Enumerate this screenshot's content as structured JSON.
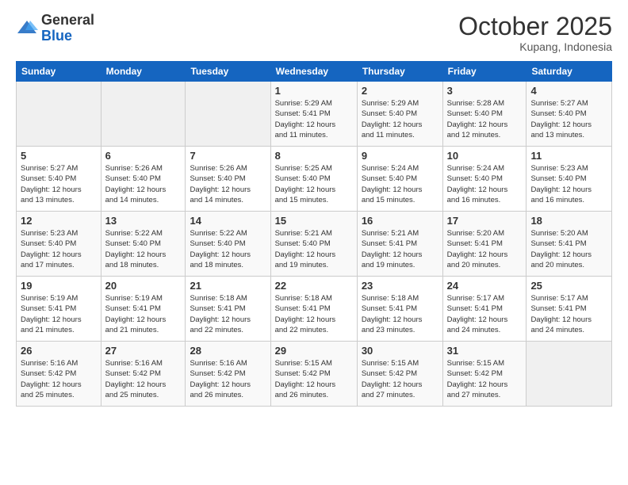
{
  "header": {
    "logo_general": "General",
    "logo_blue": "Blue",
    "month": "October 2025",
    "location": "Kupang, Indonesia"
  },
  "days_of_week": [
    "Sunday",
    "Monday",
    "Tuesday",
    "Wednesday",
    "Thursday",
    "Friday",
    "Saturday"
  ],
  "weeks": [
    [
      {
        "day": "",
        "info": ""
      },
      {
        "day": "",
        "info": ""
      },
      {
        "day": "",
        "info": ""
      },
      {
        "day": "1",
        "info": "Sunrise: 5:29 AM\nSunset: 5:41 PM\nDaylight: 12 hours\nand 11 minutes."
      },
      {
        "day": "2",
        "info": "Sunrise: 5:29 AM\nSunset: 5:40 PM\nDaylight: 12 hours\nand 11 minutes."
      },
      {
        "day": "3",
        "info": "Sunrise: 5:28 AM\nSunset: 5:40 PM\nDaylight: 12 hours\nand 12 minutes."
      },
      {
        "day": "4",
        "info": "Sunrise: 5:27 AM\nSunset: 5:40 PM\nDaylight: 12 hours\nand 13 minutes."
      }
    ],
    [
      {
        "day": "5",
        "info": "Sunrise: 5:27 AM\nSunset: 5:40 PM\nDaylight: 12 hours\nand 13 minutes."
      },
      {
        "day": "6",
        "info": "Sunrise: 5:26 AM\nSunset: 5:40 PM\nDaylight: 12 hours\nand 14 minutes."
      },
      {
        "day": "7",
        "info": "Sunrise: 5:26 AM\nSunset: 5:40 PM\nDaylight: 12 hours\nand 14 minutes."
      },
      {
        "day": "8",
        "info": "Sunrise: 5:25 AM\nSunset: 5:40 PM\nDaylight: 12 hours\nand 15 minutes."
      },
      {
        "day": "9",
        "info": "Sunrise: 5:24 AM\nSunset: 5:40 PM\nDaylight: 12 hours\nand 15 minutes."
      },
      {
        "day": "10",
        "info": "Sunrise: 5:24 AM\nSunset: 5:40 PM\nDaylight: 12 hours\nand 16 minutes."
      },
      {
        "day": "11",
        "info": "Sunrise: 5:23 AM\nSunset: 5:40 PM\nDaylight: 12 hours\nand 16 minutes."
      }
    ],
    [
      {
        "day": "12",
        "info": "Sunrise: 5:23 AM\nSunset: 5:40 PM\nDaylight: 12 hours\nand 17 minutes."
      },
      {
        "day": "13",
        "info": "Sunrise: 5:22 AM\nSunset: 5:40 PM\nDaylight: 12 hours\nand 18 minutes."
      },
      {
        "day": "14",
        "info": "Sunrise: 5:22 AM\nSunset: 5:40 PM\nDaylight: 12 hours\nand 18 minutes."
      },
      {
        "day": "15",
        "info": "Sunrise: 5:21 AM\nSunset: 5:40 PM\nDaylight: 12 hours\nand 19 minutes."
      },
      {
        "day": "16",
        "info": "Sunrise: 5:21 AM\nSunset: 5:41 PM\nDaylight: 12 hours\nand 19 minutes."
      },
      {
        "day": "17",
        "info": "Sunrise: 5:20 AM\nSunset: 5:41 PM\nDaylight: 12 hours\nand 20 minutes."
      },
      {
        "day": "18",
        "info": "Sunrise: 5:20 AM\nSunset: 5:41 PM\nDaylight: 12 hours\nand 20 minutes."
      }
    ],
    [
      {
        "day": "19",
        "info": "Sunrise: 5:19 AM\nSunset: 5:41 PM\nDaylight: 12 hours\nand 21 minutes."
      },
      {
        "day": "20",
        "info": "Sunrise: 5:19 AM\nSunset: 5:41 PM\nDaylight: 12 hours\nand 21 minutes."
      },
      {
        "day": "21",
        "info": "Sunrise: 5:18 AM\nSunset: 5:41 PM\nDaylight: 12 hours\nand 22 minutes."
      },
      {
        "day": "22",
        "info": "Sunrise: 5:18 AM\nSunset: 5:41 PM\nDaylight: 12 hours\nand 22 minutes."
      },
      {
        "day": "23",
        "info": "Sunrise: 5:18 AM\nSunset: 5:41 PM\nDaylight: 12 hours\nand 23 minutes."
      },
      {
        "day": "24",
        "info": "Sunrise: 5:17 AM\nSunset: 5:41 PM\nDaylight: 12 hours\nand 24 minutes."
      },
      {
        "day": "25",
        "info": "Sunrise: 5:17 AM\nSunset: 5:41 PM\nDaylight: 12 hours\nand 24 minutes."
      }
    ],
    [
      {
        "day": "26",
        "info": "Sunrise: 5:16 AM\nSunset: 5:42 PM\nDaylight: 12 hours\nand 25 minutes."
      },
      {
        "day": "27",
        "info": "Sunrise: 5:16 AM\nSunset: 5:42 PM\nDaylight: 12 hours\nand 25 minutes."
      },
      {
        "day": "28",
        "info": "Sunrise: 5:16 AM\nSunset: 5:42 PM\nDaylight: 12 hours\nand 26 minutes."
      },
      {
        "day": "29",
        "info": "Sunrise: 5:15 AM\nSunset: 5:42 PM\nDaylight: 12 hours\nand 26 minutes."
      },
      {
        "day": "30",
        "info": "Sunrise: 5:15 AM\nSunset: 5:42 PM\nDaylight: 12 hours\nand 27 minutes."
      },
      {
        "day": "31",
        "info": "Sunrise: 5:15 AM\nSunset: 5:42 PM\nDaylight: 12 hours\nand 27 minutes."
      },
      {
        "day": "",
        "info": ""
      }
    ]
  ]
}
